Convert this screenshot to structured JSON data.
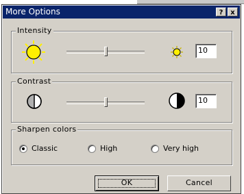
{
  "window": {
    "title": "More Options",
    "help_label": "?",
    "close_label": "x"
  },
  "intensity": {
    "label": "Intensity",
    "slider_level": 0.5,
    "value": "10"
  },
  "contrast": {
    "label": "Contrast",
    "slider_level": 0.5,
    "value": "10"
  },
  "sharpen": {
    "label": "Sharpen colors",
    "options": [
      {
        "label": "Classic",
        "selected": true
      },
      {
        "label": "High",
        "selected": false
      },
      {
        "label": "Very high",
        "selected": false
      }
    ]
  },
  "buttons": {
    "ok_label": "OK",
    "cancel_label": "Cancel"
  },
  "colors": {
    "title_bar": "#0a246a",
    "dialog_face": "#d4d0c8",
    "sun": "#ffef00"
  }
}
